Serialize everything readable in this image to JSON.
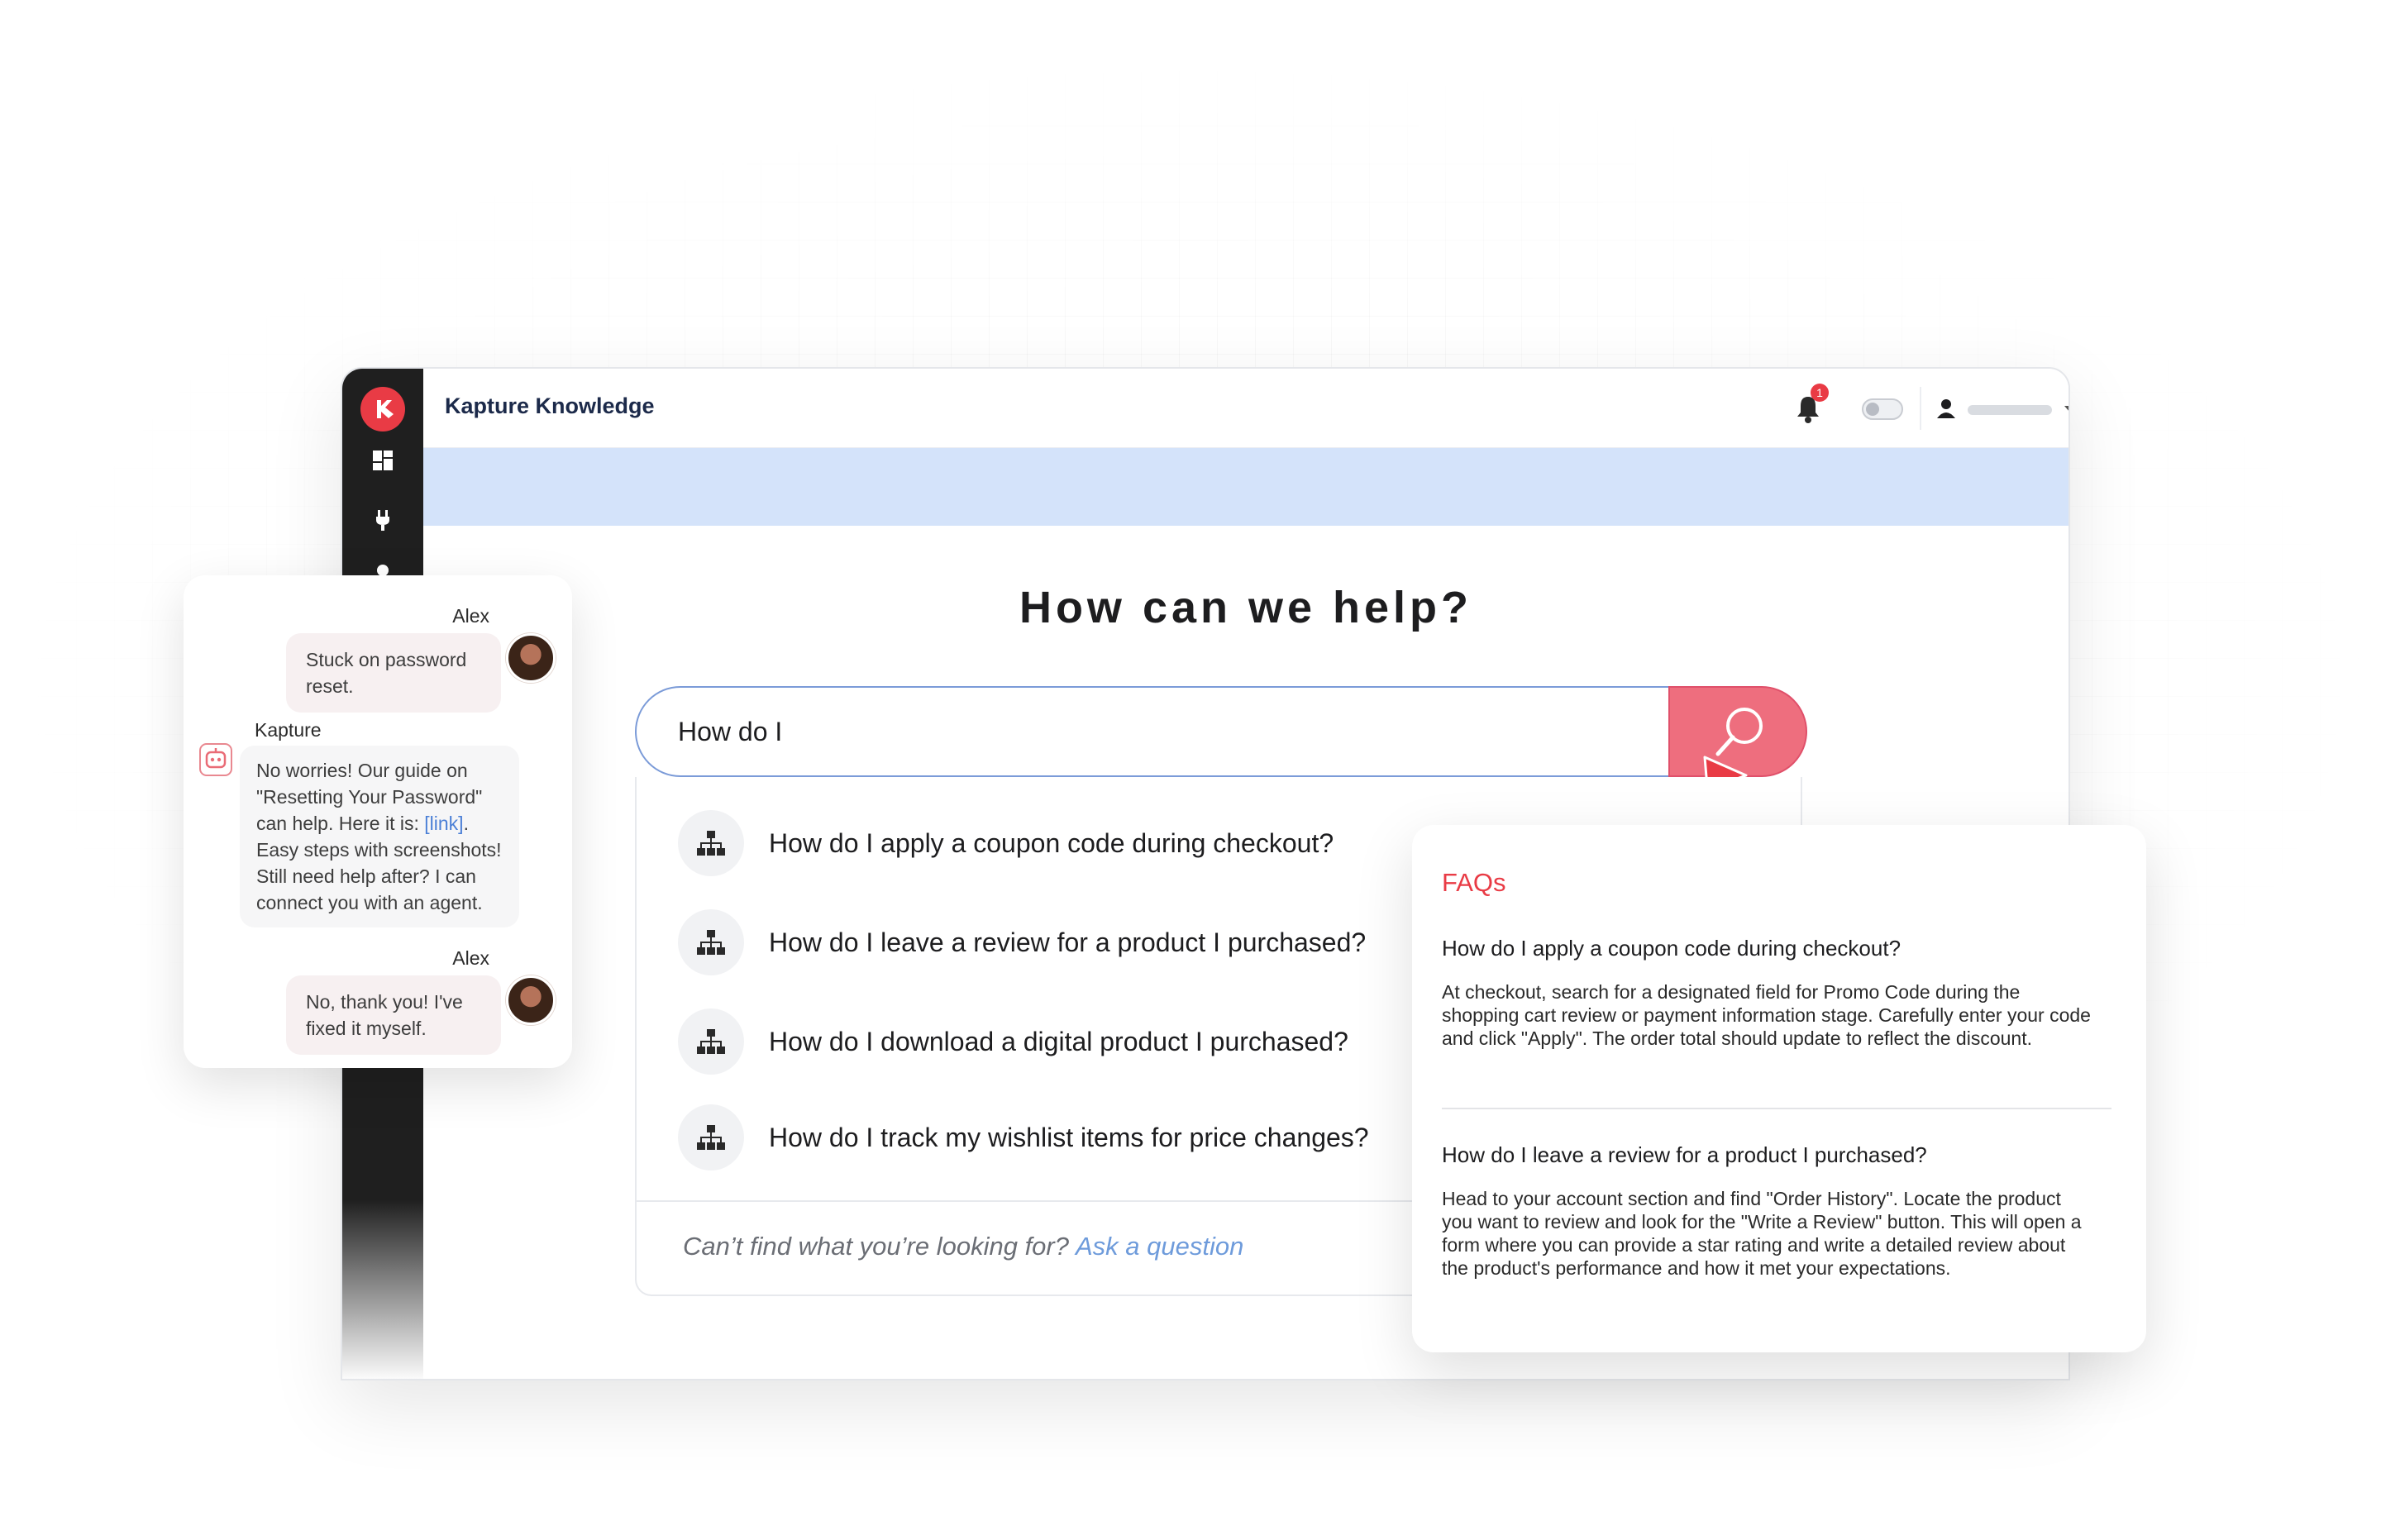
{
  "app": {
    "title": "Kapture Knowledge",
    "notification_count": "1"
  },
  "hero": {
    "title": "How can we help?"
  },
  "search": {
    "value": "How do I"
  },
  "suggestions": [
    {
      "icon": "sitemap-icon",
      "text": "How do I apply a coupon code during checkout?"
    },
    {
      "icon": "sitemap-icon",
      "text": "How do I leave a review for a product I purchased?"
    },
    {
      "icon": "sitemap-icon",
      "text": "How do I download a digital product I purchased?"
    },
    {
      "icon": "sitemap-icon",
      "text": "How do I track my wishlist items for price changes?"
    }
  ],
  "footer": {
    "prompt": "Can’t find what you’re looking for?",
    "link": "Ask a question"
  },
  "chat": {
    "user_name_1": "Alex",
    "user_msg_1": "Stuck on password reset.",
    "bot_name": "Kapture",
    "bot_msg_pre": "No worries! Our guide on \"Resetting Your Password\" can help. Here it is: ",
    "bot_msg_link": "[link]",
    "bot_msg_post": ". Easy steps with screenshots! Still need help after? I can connect you with an agent.",
    "user_name_2": "Alex",
    "user_msg_2": "No, thank you! I've fixed it myself."
  },
  "faq": {
    "heading": "FAQs",
    "items": [
      {
        "question": "How do I apply a coupon code during checkout?",
        "answer": "At checkout, search for a designated field for Promo Code during the shopping cart review or payment information stage.  Carefully enter your code and click \"Apply\". The order total should update to reflect the discount."
      },
      {
        "question": "How do I leave a review for a product I purchased?",
        "answer": "Head to your account section and find \"Order History\". Locate the product you want to review and look for the \"Write a Review\" button. This will open a form where you can provide a star rating and write a detailed review about the product's performance and how it met your expectations."
      }
    ]
  },
  "colors": {
    "brand_red": "#e93b45",
    "banner_blue": "#d4e3fa",
    "search_button": "#ee6e7e",
    "link_blue": "#6e9bdb",
    "sidebar_dark": "#1f1f1f"
  }
}
